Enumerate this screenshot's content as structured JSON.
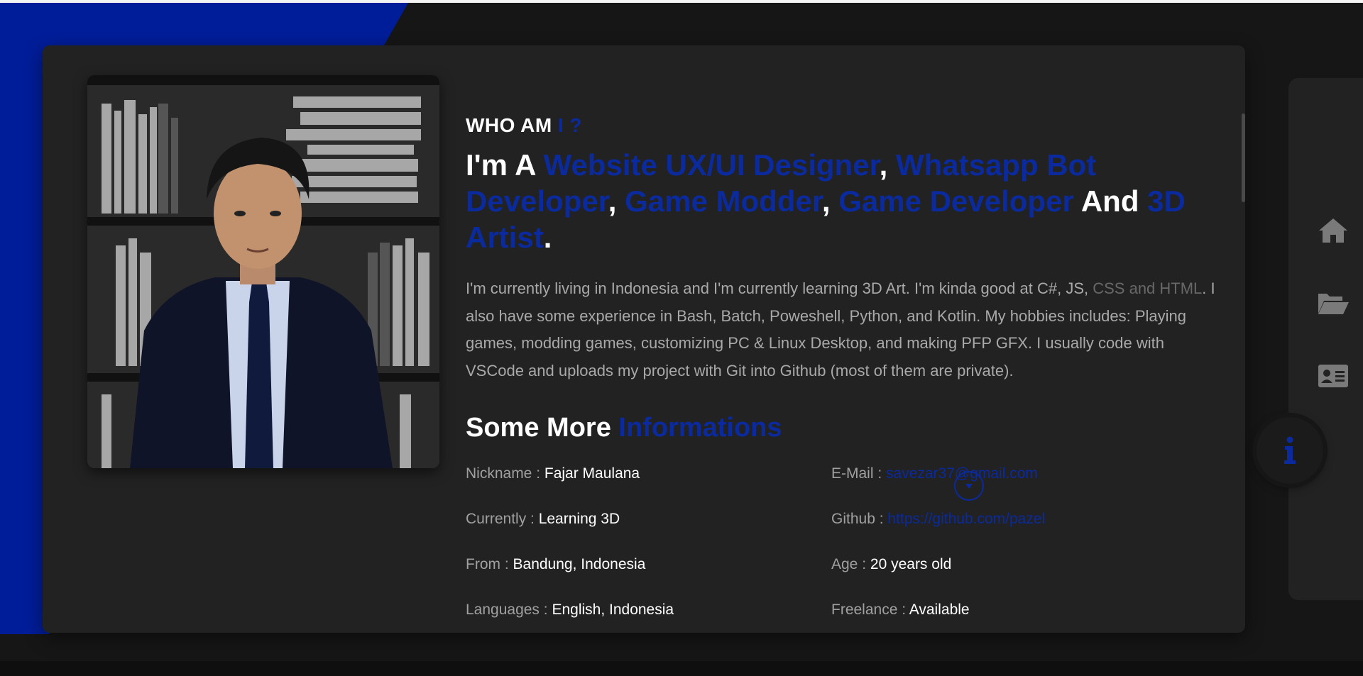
{
  "colors": {
    "accent": "#0a2a9e",
    "card_bg": "#222222",
    "page_bg": "#161616",
    "blue_shape": "#001d99"
  },
  "about": {
    "eyebrow_prefix": "WHO AM",
    "eyebrow_accent": "I ?",
    "headline": {
      "intro": "I'm A",
      "role1": "Website UX/UI Designer",
      "sep1": ",",
      "role2": "Whatsapp Bot Developer",
      "sep2": ",",
      "role3": "Game Modder",
      "sep3": ",",
      "role4": "Game Developer",
      "conj": "And",
      "role5": "3D Artist",
      "end": "."
    },
    "bio": {
      "part1": "I'm currently living in Indonesia and I'm currently learning 3D Art. I'm kinda good at C#, JS, ",
      "muted": "CSS and HTML",
      "part2": ". I also have some experience in Bash, Batch, Poweshell, Python, and Kotlin. My hobbies includes: Playing games, modding games, customizing PC & Linux Desktop, and making PFP GFX. I usually code with VSCode and uploads my project with Git into Github (most of them are private)."
    }
  },
  "more_info": {
    "title_prefix": "Some More",
    "title_accent": "Informations",
    "rows": [
      {
        "left": {
          "label": "Nickname :",
          "value": "Fajar Maulana"
        },
        "right": {
          "label": "E-Mail :",
          "value": "savezar37@gmail.com"
        }
      },
      {
        "left": {
          "label": "Currently :",
          "value": "Learning 3D"
        },
        "right": {
          "label": "Github :",
          "value": "https://github.com/pazel"
        }
      },
      {
        "left": {
          "label": "From :",
          "value": "Bandung, Indonesia"
        },
        "right": {
          "label": "Age :",
          "value": "20 years old"
        }
      },
      {
        "left": {
          "label": "Languages :",
          "value": "English, Indonesia"
        },
        "right": {
          "label": "Freelance :",
          "value": "Available"
        }
      }
    ]
  },
  "nav": {
    "items": [
      {
        "icon": "home-icon"
      },
      {
        "icon": "folder-open-icon"
      },
      {
        "icon": "contact-card-icon"
      },
      {
        "icon": "info-icon",
        "active": true
      }
    ]
  }
}
